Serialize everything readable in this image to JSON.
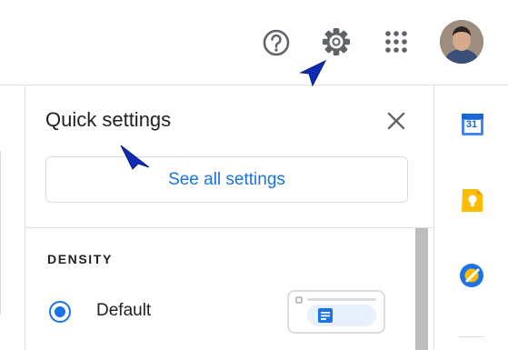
{
  "header": {
    "help_icon": "help-circle-icon",
    "settings_icon": "gear-icon",
    "apps_icon": "apps-grid-icon"
  },
  "quick_settings": {
    "title": "Quick settings",
    "see_all_label": "See all settings",
    "density": {
      "heading": "DENSITY",
      "selected": "Default",
      "options": [
        "Default"
      ]
    }
  },
  "side_panel": {
    "calendar_day": "31",
    "apps": [
      "calendar-icon",
      "keep-icon",
      "tasks-icon"
    ]
  },
  "colors": {
    "accent": "#1a73e8",
    "calendar": "#4285f4",
    "keep": "#fbbc04",
    "tasks": "#1a73e8",
    "cursor": "#0f2bb3"
  }
}
